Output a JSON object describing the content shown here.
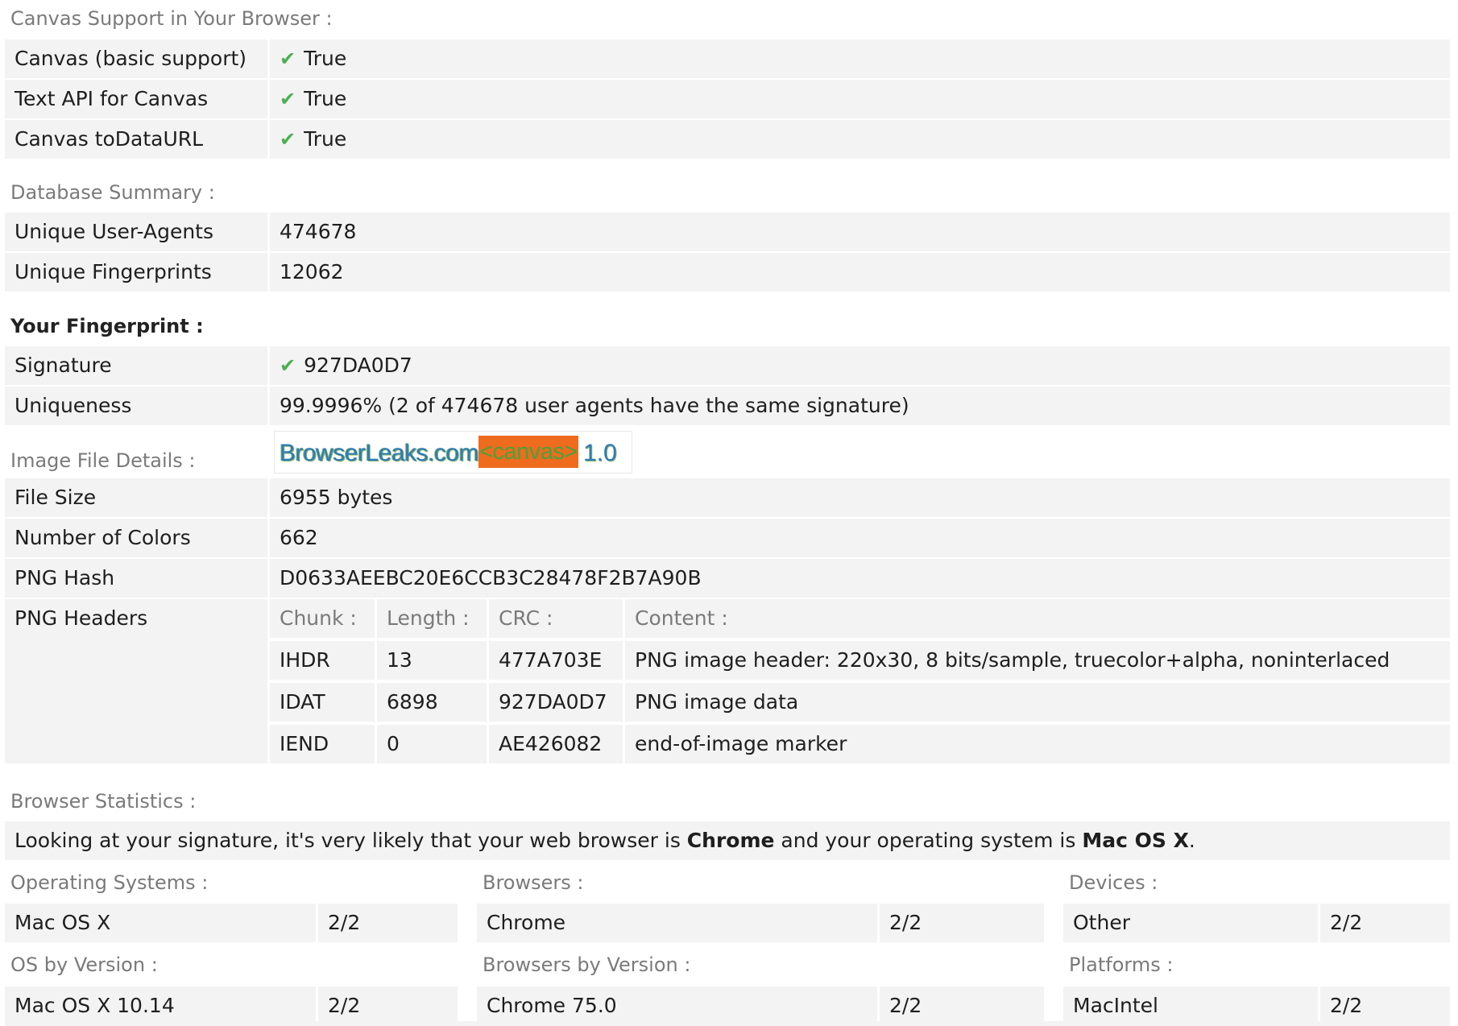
{
  "canvas_support": {
    "title": "Canvas Support in Your Browser :",
    "rows": [
      {
        "label": "Canvas (basic support)",
        "value": "True"
      },
      {
        "label": "Text API for Canvas",
        "value": "True"
      },
      {
        "label": "Canvas toDataURL",
        "value": "True"
      }
    ]
  },
  "database_summary": {
    "title": "Database Summary :",
    "rows": [
      {
        "label": "Unique User-Agents",
        "value": "474678"
      },
      {
        "label": "Unique Fingerprints",
        "value": "12062"
      }
    ]
  },
  "fingerprint": {
    "title": "Your Fingerprint :",
    "signature_label": "Signature",
    "signature_value": "927DA0D7",
    "uniqueness_label": "Uniqueness",
    "uniqueness_value": "99.9996% (2 of 474678 user agents have the same signature)"
  },
  "image_file": {
    "title": "Image File Details :",
    "logo": {
      "site": "BrowserLeaks.com",
      "tag": "<canvas>",
      "version": "1.0"
    },
    "rows": [
      {
        "label": "File Size",
        "value": "6955 bytes"
      },
      {
        "label": "Number of Colors",
        "value": "662"
      },
      {
        "label": "PNG Hash",
        "value": "D0633AEEBC20E6CCB3C28478F2B7A90B"
      }
    ],
    "png_headers_label": "PNG Headers",
    "png_headers_columns": [
      "Chunk :",
      "Length :",
      "CRC :",
      "Content :"
    ],
    "png_headers_rows": [
      [
        "IHDR",
        "13",
        "477A703E",
        "PNG image header: 220x30, 8 bits/sample, truecolor+alpha, noninterlaced"
      ],
      [
        "IDAT",
        "6898",
        "927DA0D7",
        "PNG image data"
      ],
      [
        "IEND",
        "0",
        "AE426082",
        "end-of-image marker"
      ]
    ]
  },
  "browser_statistics": {
    "title": "Browser Statistics :",
    "summary_prefix": "Looking at your signature, it's very likely that your web browser is ",
    "browser": "Chrome",
    "summary_middle": " and your operating system is ",
    "os": "Mac OS X",
    "summary_suffix": ".",
    "groups": [
      {
        "title": "Operating Systems :",
        "name": "Mac OS X",
        "count": "2/2"
      },
      {
        "title": "Browsers :",
        "name": "Chrome",
        "count": "2/2"
      },
      {
        "title": "Devices :",
        "name": "Other",
        "count": "2/2"
      },
      {
        "title": "OS by Version :",
        "name": "Mac OS X 10.14",
        "count": "2/2"
      },
      {
        "title": "Browsers by Version :",
        "name": "Chrome 75.0",
        "count": "2/2"
      },
      {
        "title": "Platforms :",
        "name": "MacIntel",
        "count": "2/2"
      }
    ]
  },
  "colors": {
    "check": "#4caf50",
    "row_bg": "#f3f3f3",
    "canvas_tag_bg": "#ef6b1e"
  }
}
